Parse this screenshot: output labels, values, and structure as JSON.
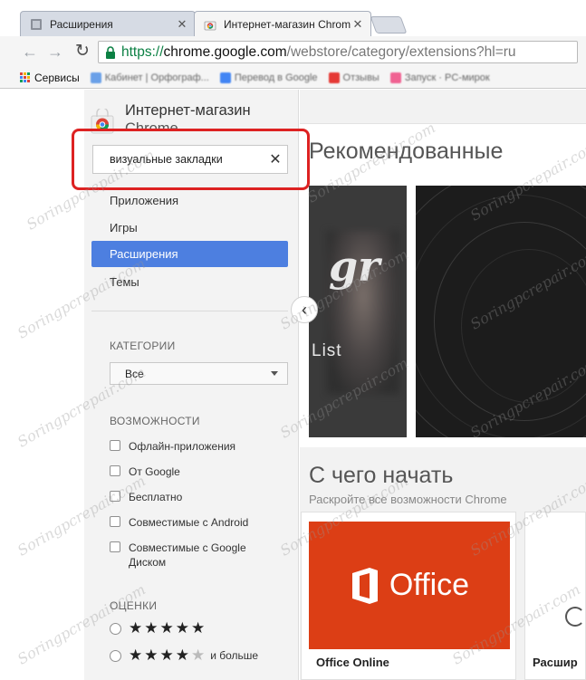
{
  "tabs": [
    {
      "title": "Расширения",
      "active": false
    },
    {
      "title": "Интернет-магазин Chrom",
      "active": true
    }
  ],
  "toolbar": {
    "url_scheme": "https://",
    "url_host": "chrome.google.com",
    "url_path": "/webstore/category/extensions?hl=ru"
  },
  "bookmarks": {
    "apps_label": "Сервисы",
    "items": [
      "Кабинет | Орфограф...",
      "Перевод в Google",
      "Отзывы",
      "Запуск · PC-мирок"
    ]
  },
  "store": {
    "title_line1": "Интернет-магазин",
    "title_line2": "Chrome"
  },
  "search": {
    "value": "визуальные закладки"
  },
  "nav": [
    {
      "label": "Приложения",
      "active": false
    },
    {
      "label": "Игры",
      "active": false
    },
    {
      "label": "Расширения",
      "active": true
    },
    {
      "label": "Темы",
      "active": false
    }
  ],
  "categories": {
    "heading": "КАТЕГОРИИ",
    "selected": "Все"
  },
  "features": {
    "heading": "ВОЗМОЖНОСТИ",
    "items": [
      "Офлайн-приложения",
      "От Google",
      "Бесплатно",
      "Совместимые с Android",
      "Совместимые с Google Диском"
    ]
  },
  "ratings": {
    "heading": "ОЦЕНКИ",
    "and_more": "и больше"
  },
  "main": {
    "recommended_title": "Рекомендованные",
    "banner_text_big": "gr",
    "banner_text_small": "List",
    "start_title": "С чего начать",
    "start_subtitle": "Раскройте все возможности Chrome",
    "office_tile_word": "Office",
    "card1_name": "Office Online",
    "card2_name": "Расшир"
  },
  "watermark": "Soringpcrepair.com",
  "colors": {
    "accent": "#4d7fe0",
    "highlight": "#dd2222",
    "office": "#dc3e15",
    "secure": "#0b8043"
  }
}
